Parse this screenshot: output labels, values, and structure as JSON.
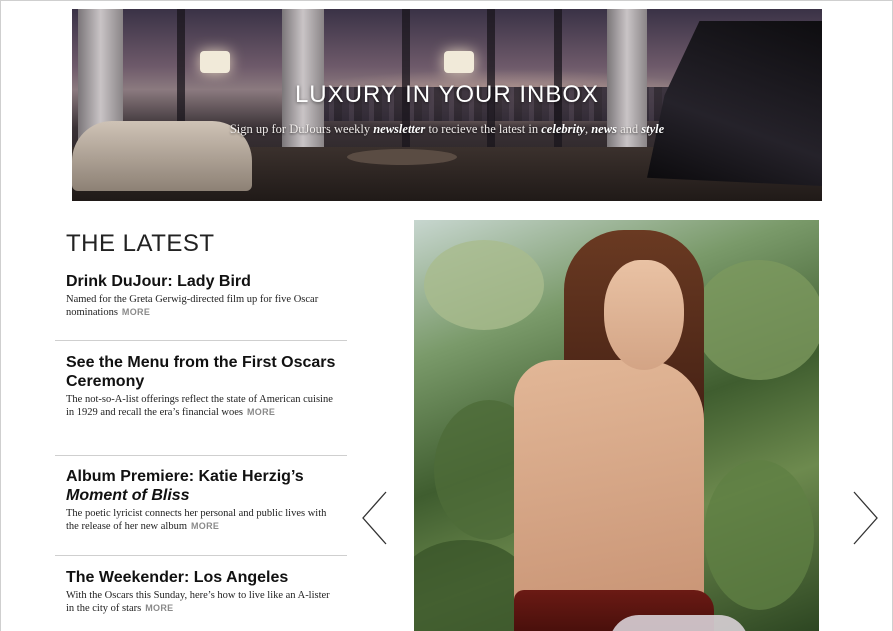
{
  "banner": {
    "title": "LUXURY IN YOUR INBOX",
    "subtitle_start": "Sign up for DuJours weekly ",
    "subtitle_newsletter": "newsletter",
    "subtitle_mid": " to recieve the latest in ",
    "subtitle_celebrity": "celebrity",
    "subtitle_comma": ", ",
    "subtitle_news": "news",
    "subtitle_and": " and ",
    "subtitle_style": "style"
  },
  "latest": {
    "heading": "THE LATEST",
    "more_label": "MORE",
    "articles": [
      {
        "title": "Drink DuJour: Lady Bird",
        "description": "Named for the Greta Gerwig-directed film up for five Oscar nominations"
      },
      {
        "title": "See the Menu from the First Oscars Ceremony",
        "description": "The not-so-A-list offerings reflect the state of American cuisine in 1929 and recall the era’s financial woes"
      },
      {
        "title_part1": "Album Premiere: Katie Herzig’s",
        "title_part2": "Moment of Bliss",
        "description": "The poetic lyricist connects her personal and public lives with the release of her new album"
      },
      {
        "title": "The Weekender: Los Angeles",
        "description": "With the Oscars this Sunday, here’s how to live like an A-lister in the city of stars"
      }
    ]
  },
  "slideshow": {
    "prev_icon": "chevron-left-icon",
    "next_icon": "chevron-right-icon"
  },
  "colors": {
    "more_link": "#8a8a8a",
    "divider": "#cfcfcf",
    "text": "#111111"
  }
}
